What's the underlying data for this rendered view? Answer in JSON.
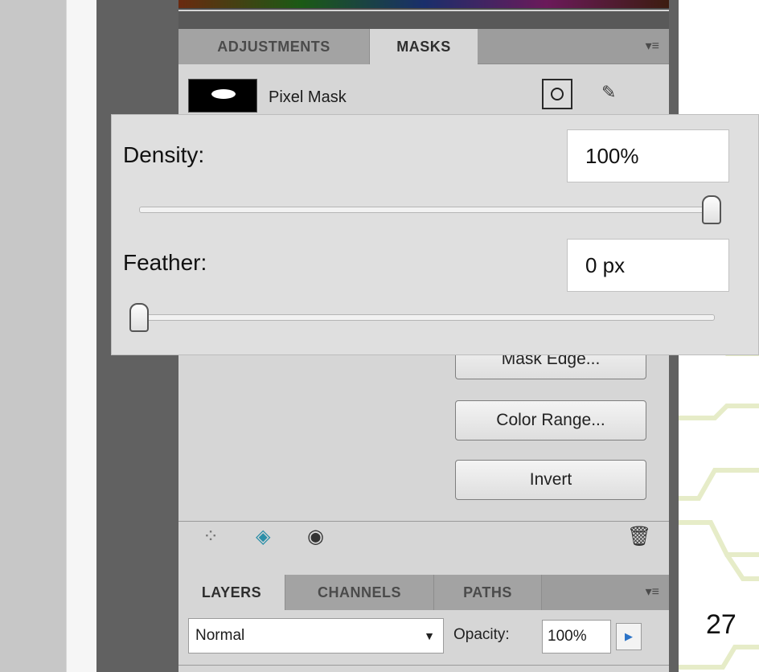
{
  "masks_panel": {
    "tabs": [
      "ADJUSTMENTS",
      "MASKS"
    ],
    "active_tab": "MASKS",
    "menu_icon": "≡",
    "pixel_mask_label": "Pixel Mask",
    "buttons": {
      "mask_edge": "Mask Edge...",
      "color_range": "Color Range...",
      "invert": "Invert"
    },
    "footer_icons": [
      "selection-icon",
      "apply-mask-icon",
      "eye-icon",
      "trash-icon"
    ]
  },
  "popup": {
    "density_label": "Density:",
    "density_value": "100%",
    "density_level": 1.0,
    "feather_label": "Feather:",
    "feather_value": "0 px",
    "feather_level": 0.0
  },
  "layers_panel": {
    "tabs": [
      "LAYERS",
      "CHANNELS",
      "PATHS"
    ],
    "active_tab": "LAYERS",
    "menu_icon": "≡",
    "blend_mode": "Normal",
    "opacity_label": "Opacity:",
    "opacity_value": "100%"
  },
  "slide": {
    "page_number": "27"
  },
  "colors": {
    "panel_bg": "#d6d6d6",
    "tab_bar": "#9d9d9d",
    "dark_gutter": "#616161",
    "deco_line": "#e6ecc8"
  }
}
